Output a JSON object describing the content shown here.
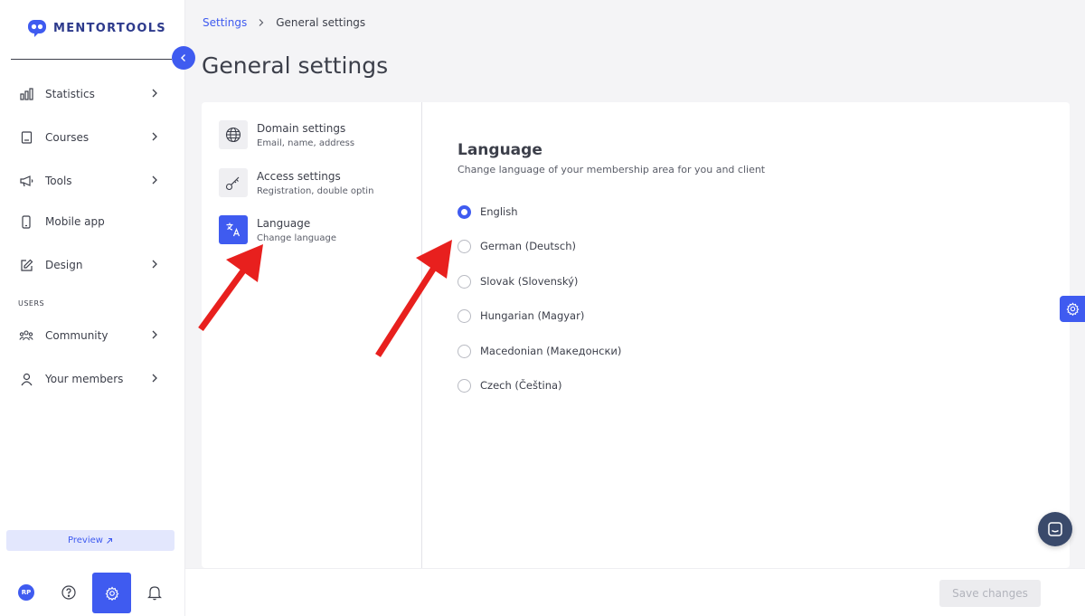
{
  "brand": {
    "name": "MENTORTOOLS",
    "accent": "#3f5bf0"
  },
  "sidebar": {
    "items": [
      {
        "label": "Statistics",
        "icon": "bar-chart-icon",
        "has_chevron": true
      },
      {
        "label": "Courses",
        "icon": "book-icon",
        "has_chevron": true
      },
      {
        "label": "Tools",
        "icon": "megaphone-icon",
        "has_chevron": true
      },
      {
        "label": "Mobile app",
        "icon": "phone-icon",
        "has_chevron": false
      },
      {
        "label": "Design",
        "icon": "pencil-icon",
        "has_chevron": true
      }
    ],
    "users_heading": "USERS",
    "user_items": [
      {
        "label": "Community",
        "icon": "community-icon",
        "has_chevron": true
      },
      {
        "label": "Your members",
        "icon": "user-icon",
        "has_chevron": true
      }
    ],
    "preview_label": "Preview",
    "avatar_initials": "RP"
  },
  "breadcrumb": {
    "parent": "Settings",
    "current": "General settings"
  },
  "page_title": "General settings",
  "settings_menu": [
    {
      "title": "Domain settings",
      "desc": "Email, name, address",
      "icon": "globe-icon",
      "active": false
    },
    {
      "title": "Access settings",
      "desc": "Registration, double optin",
      "icon": "key-icon",
      "active": false
    },
    {
      "title": "Language",
      "desc": "Change language",
      "icon": "translate-icon",
      "active": true
    }
  ],
  "language_panel": {
    "heading": "Language",
    "subheading": "Change language of your membership area for you and client",
    "options": [
      {
        "label": "English",
        "selected": true
      },
      {
        "label": "German (Deutsch)",
        "selected": false
      },
      {
        "label": "Slovak (Slovenský)",
        "selected": false
      },
      {
        "label": "Hungarian (Magyar)",
        "selected": false
      },
      {
        "label": "Macedonian (Македонски)",
        "selected": false
      },
      {
        "label": "Czech (Čeština)",
        "selected": false
      }
    ]
  },
  "footer": {
    "save_label": "Save changes"
  },
  "annotation_color": "#e8201e"
}
